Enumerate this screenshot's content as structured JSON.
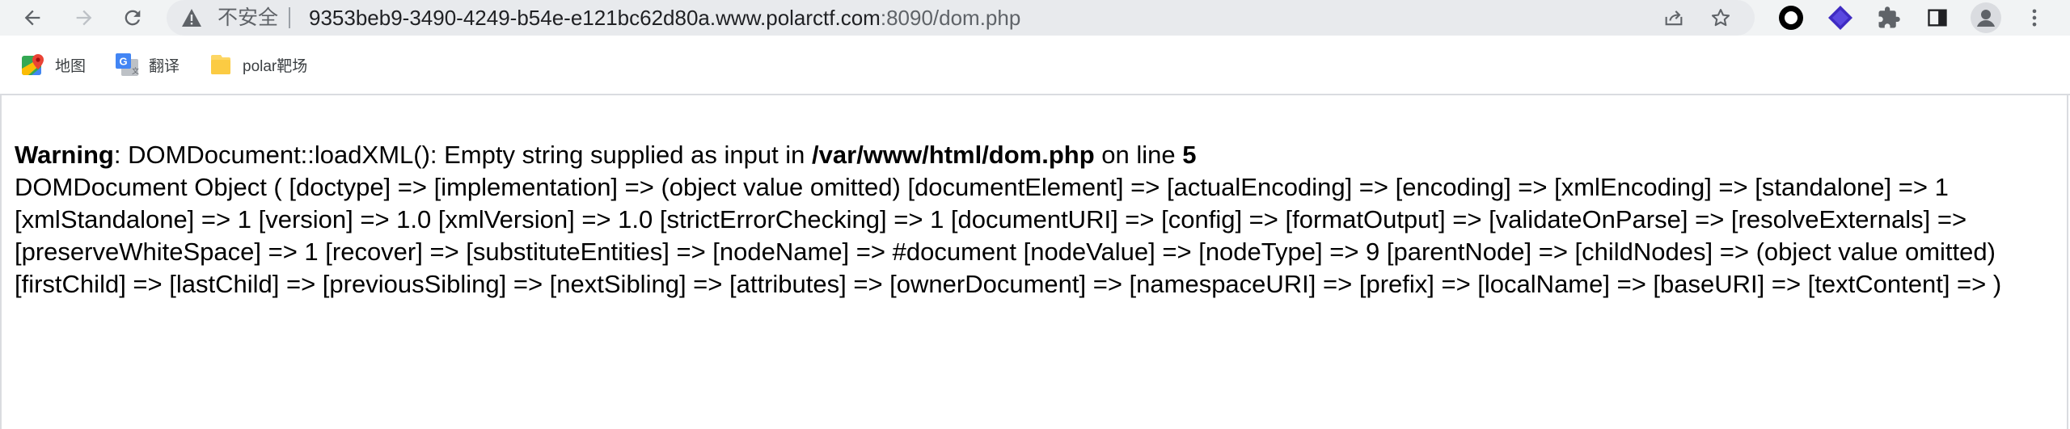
{
  "browser": {
    "address_bar": {
      "security_label": "不安全",
      "url_host": "9353beb9-3490-4249-b54e-e121bc62d80a.www.polarctf.com",
      "url_rest": ":8090/dom.php"
    },
    "bookmarks": [
      {
        "label": "地图",
        "icon": "maps-icon"
      },
      {
        "label": "翻译",
        "icon": "translate-icon"
      },
      {
        "label": "polar靶场",
        "icon": "folder-icon"
      }
    ],
    "icons": {
      "back": "arrow-left-icon",
      "forward": "arrow-right-icon",
      "reload": "reload-icon",
      "not_secure": "warning-triangle-icon",
      "share": "share-icon",
      "bookmark": "star-icon",
      "extensions": [
        "circle-extension-icon",
        "diamond-extension-icon",
        "puzzle-icon"
      ],
      "side_panel": "side-panel-icon",
      "profile": "avatar-icon",
      "menu": "kebab-menu-icon"
    }
  },
  "page": {
    "warning": {
      "prefix": "Warning",
      "colon_text": ": DOMDocument::loadXML(): Empty string supplied as input in ",
      "path": "/var/www/html/dom.php",
      "on_line_text": " on line ",
      "line": "5"
    },
    "dump": "DOMDocument Object ( [doctype] => [implementation] => (object value omitted) [documentElement] => [actualEncoding] => [encoding] => [xmlEncoding] => [standalone] => 1 [xmlStandalone] => 1 [version] => 1.0 [xmlVersion] => 1.0 [strictErrorChecking] => 1 [documentURI] => [config] => [formatOutput] => [validateOnParse] => [resolveExternals] => [preserveWhiteSpace] => 1 [recover] => [substituteEntities] => [nodeName] => #document [nodeValue] => [nodeType] => 9 [parentNode] => [childNodes] => (object value omitted) [firstChild] => [lastChild] => [previousSibling] => [nextSibling] => [attributes] => [ownerDocument] => [namespaceURI] => [prefix] => [localName] => [baseURI] => [textContent] => )"
  },
  "colors": {
    "toolbar_bg": "#f1f3f4",
    "omnibox_bg": "#e8eaed",
    "icon_gray": "#5f6368",
    "extension_purple": "#3f2bc2"
  }
}
